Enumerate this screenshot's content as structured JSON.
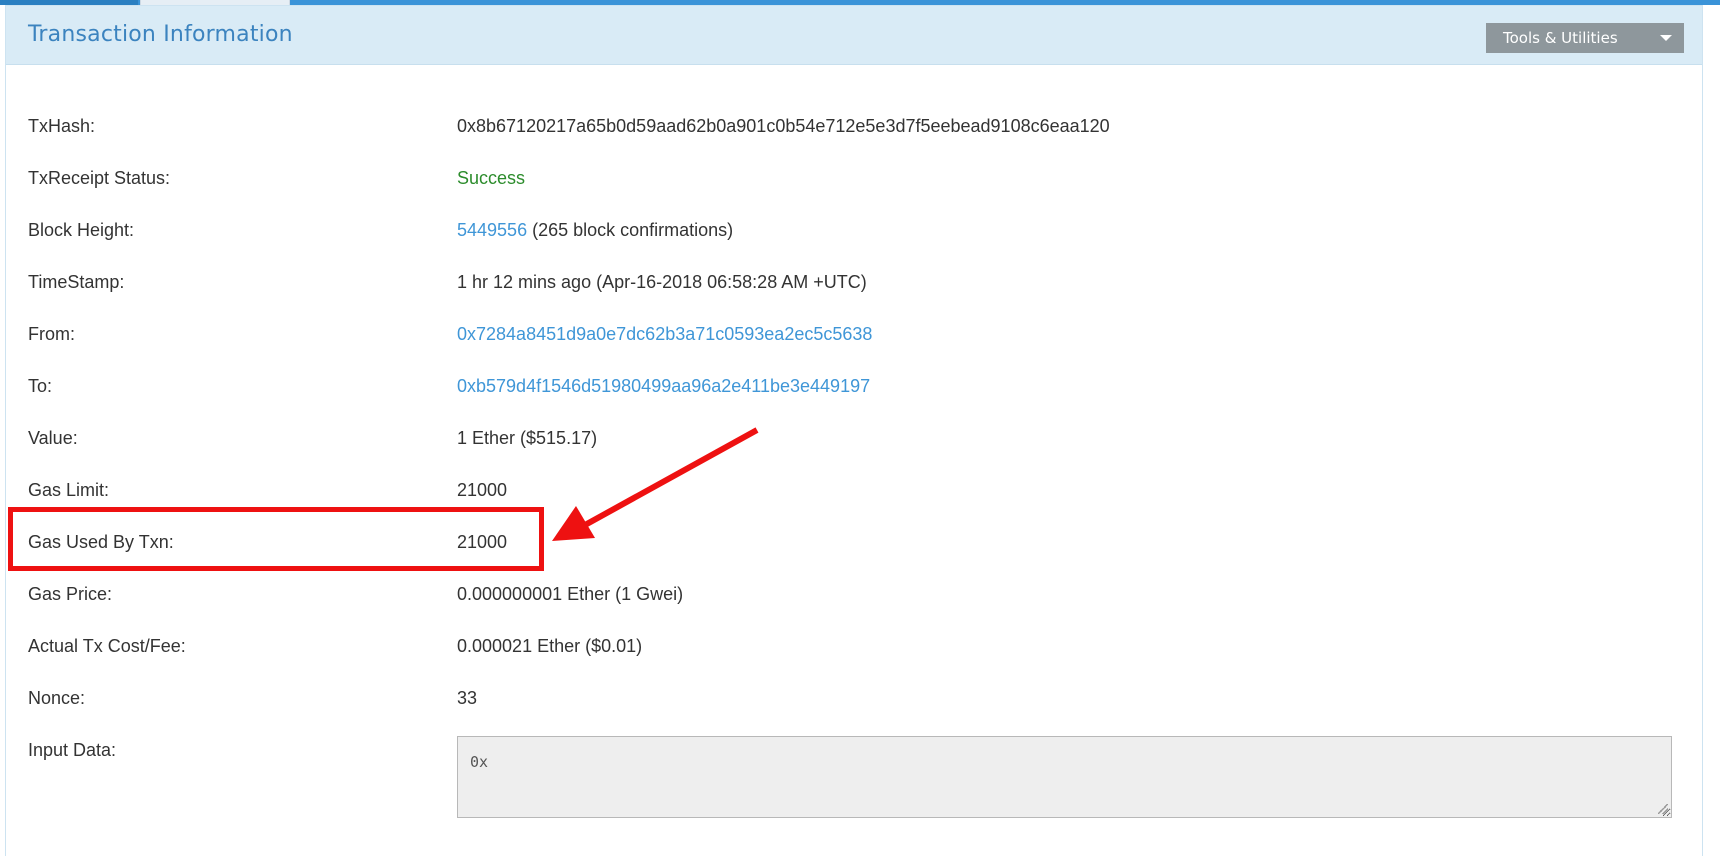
{
  "panel": {
    "title": "Transaction Information",
    "tools_label": "Tools & Utilities"
  },
  "rows": [
    {
      "label": "TxHash:",
      "value": "0x8b67120217a65b0d59aad62b0a901c0b54e712e5e3d7f5eebead9108c6eaa120"
    },
    {
      "label": "TxReceipt Status:",
      "value": "Success"
    },
    {
      "label": "Block Height:",
      "block_link": "5449556",
      "value": " (265 block confirmations)"
    },
    {
      "label": "TimeStamp:",
      "value": "1 hr 12 mins ago (Apr-16-2018 06:58:28 AM +UTC)"
    },
    {
      "label": "From:",
      "value": "0x7284a8451d9a0e7dc62b3a71c0593ea2ec5c5638"
    },
    {
      "label": "To:",
      "value": "0xb579d4f1546d51980499aa96a2e411be3e449197"
    },
    {
      "label": "Value:",
      "value": "1 Ether ($515.17)"
    },
    {
      "label": "Gas Limit:",
      "value": "21000"
    },
    {
      "label": "Gas Used By Txn:",
      "value": "21000"
    },
    {
      "label": "Gas Price:",
      "value": "0.000000001 Ether (1 Gwei)"
    },
    {
      "label": "Actual Tx Cost/Fee:",
      "value": "0.000021 Ether ($0.01)"
    },
    {
      "label": "Nonce:",
      "value": "33"
    },
    {
      "label": "Input Data:",
      "value": "0x"
    }
  ],
  "colors": {
    "accent_blue": "#3f96d7",
    "success_green": "#2c8c2c",
    "annotation_red": "#ee1111",
    "header_bg": "#d9ebf6",
    "tools_button_bg": "#8e979c"
  },
  "annotation": {
    "shape": "rectangle-and-arrow",
    "target": "Gas Used By Txn"
  }
}
